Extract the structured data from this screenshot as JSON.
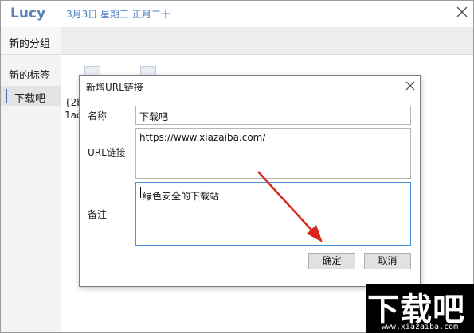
{
  "app": {
    "title": "Lucy",
    "date": "3月3日 星期三 正月二十"
  },
  "tabs": [
    {
      "label": "新的分组"
    }
  ],
  "sidebar": {
    "items": [
      {
        "label": "新的标签"
      },
      {
        "label": "下载吧"
      }
    ]
  },
  "card": {
    "line1": "{2b",
    "line2": "1ac"
  },
  "dialog": {
    "title": "新增URL链接",
    "name_label": "名称",
    "name_value": "下载吧",
    "url_label": "URL链接",
    "url_value": "https://www.xiazaiba.com/",
    "note_label": "备注",
    "note_value": "绿色安全的下载站",
    "ok_label": "确定",
    "cancel_label": "取消"
  },
  "watermark": {
    "big": "下载吧",
    "small": "www.xiazaiba.com"
  },
  "colors": {
    "accent": "#5a82b4",
    "date": "#4d7fc0",
    "arrow": "#d9261c",
    "focus_border": "#4a90d9"
  }
}
